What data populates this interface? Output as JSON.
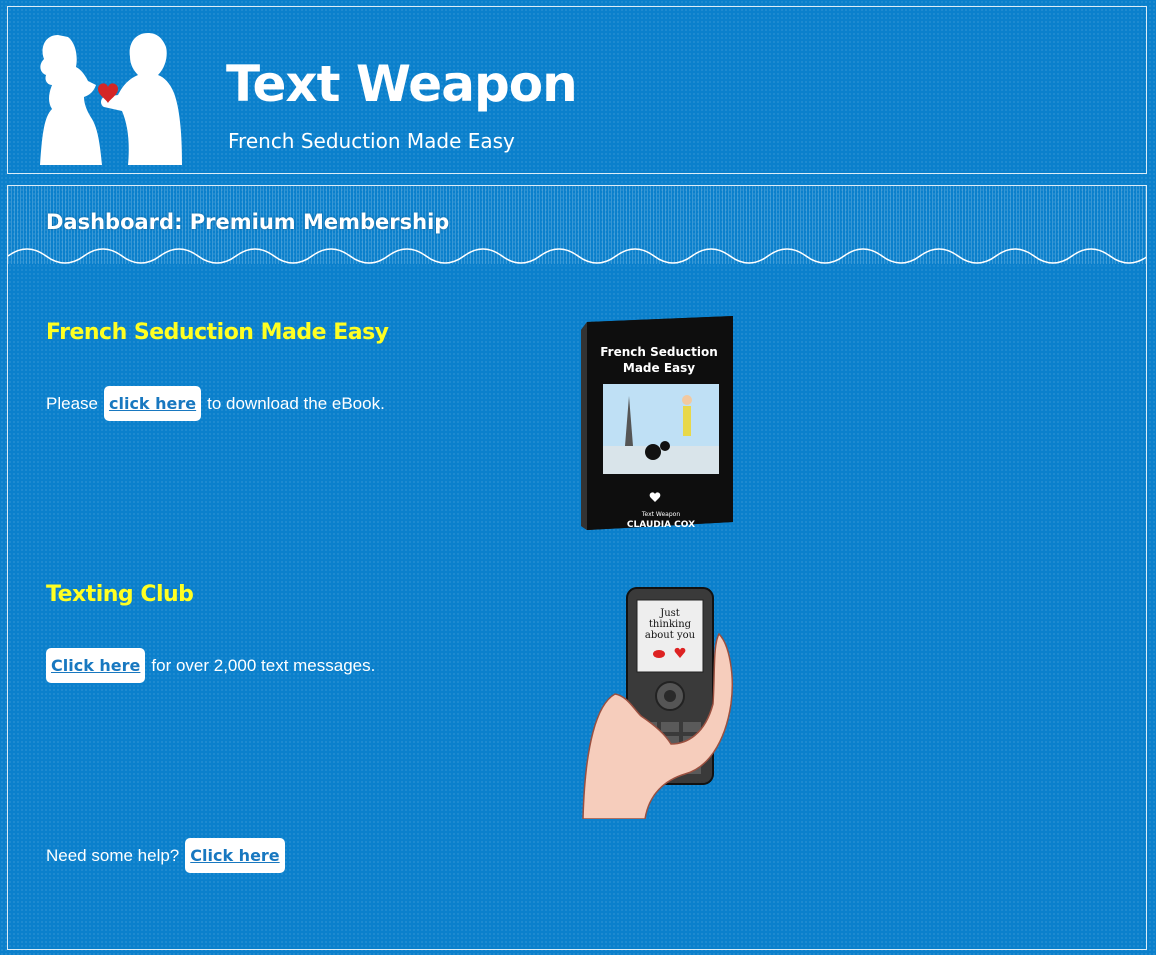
{
  "header": {
    "title": "Text Weapon",
    "subtitle": "French Seduction Made Easy"
  },
  "dashboard": {
    "title": "Dashboard: Premium Membership"
  },
  "ebook": {
    "heading": "French Seduction Made Easy",
    "prefix": "Please",
    "button": "click here",
    "suffix": "to download the eBook.",
    "cover_title_1": "French Seduction",
    "cover_title_2": "Made Easy",
    "cover_brand": "Text Weapon",
    "cover_author": "CLAUDIA COX"
  },
  "texting": {
    "heading": "Texting Club",
    "button": "Click here",
    "suffix": "for over 2,000 text messages.",
    "phone_line_1": "Just",
    "phone_line_2": "thinking",
    "phone_line_3": "about you"
  },
  "help": {
    "prefix": "Need some help?",
    "button": "Click here"
  },
  "colors": {
    "background": "#0b80cc",
    "heading_yellow": "#ffff22",
    "link_blue": "#1878c0"
  }
}
